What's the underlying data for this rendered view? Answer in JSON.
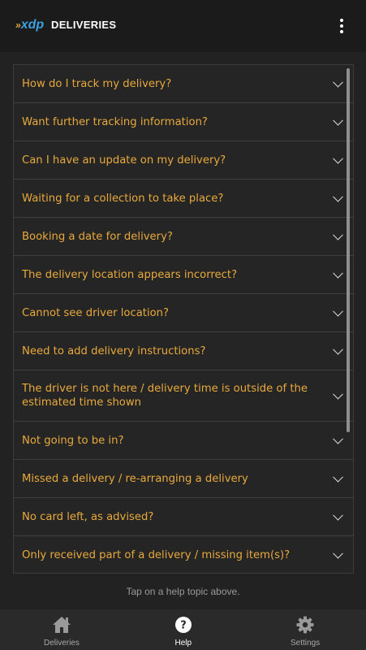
{
  "header": {
    "logo_chevrons": "»",
    "logo_text": "xdp",
    "title": "DELIVERIES",
    "menu_icon": "more-vertical-icon"
  },
  "faq": {
    "items": [
      {
        "question": "How do I track my delivery?"
      },
      {
        "question": "Want further tracking information?"
      },
      {
        "question": "Can I have an update on my delivery?"
      },
      {
        "question": "Waiting for a collection to take place?"
      },
      {
        "question": "Booking a date for delivery?"
      },
      {
        "question": "The delivery location appears incorrect?"
      },
      {
        "question": "Cannot see driver location?"
      },
      {
        "question": "Need to add delivery instructions?"
      },
      {
        "question": "The driver is not here / delivery time is outside of the estimated time shown"
      },
      {
        "question": "Not going to be in?"
      },
      {
        "question": "Missed a delivery / re-arranging a delivery"
      },
      {
        "question": "No card left, as advised?"
      },
      {
        "question": "Only received part of a delivery / missing item(s)?"
      }
    ],
    "hint": "Tap on a help topic above."
  },
  "tabs": [
    {
      "label": "Deliveries",
      "icon": "home-icon",
      "active": false
    },
    {
      "label": "Help",
      "icon": "help-icon",
      "active": true
    },
    {
      "label": "Settings",
      "icon": "gear-icon",
      "active": false
    }
  ],
  "colors": {
    "accent": "#e8a93c",
    "background": "#222222",
    "header": "#1b1b1b",
    "logo_blue": "#3aa0e0"
  }
}
